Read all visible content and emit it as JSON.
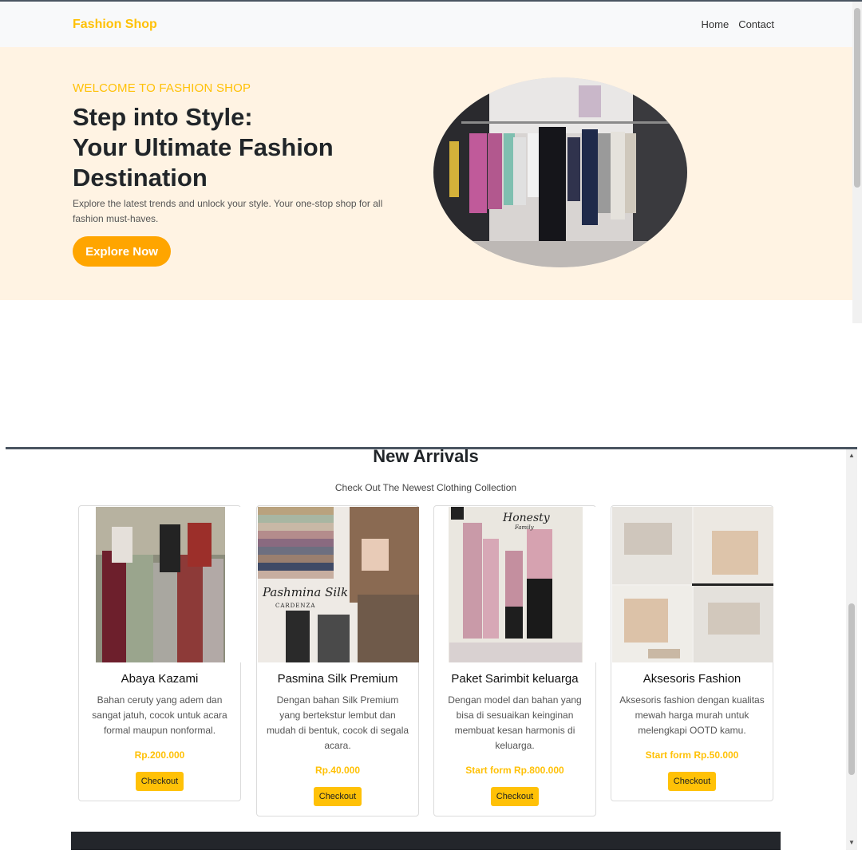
{
  "navbar": {
    "brand": "Fashion Shop",
    "links": [
      "Home",
      "Contact"
    ]
  },
  "hero": {
    "kicker": "WELCOME TO FASHION SHOP",
    "title_lines": [
      "Step into Style:",
      "Your Ultimate Fashion",
      "Destination"
    ],
    "description": "Explore the latest trends and unlock your style. Your one-stop shop for all fashion must-haves.",
    "button_label": "Explore Now"
  },
  "new_arrivals": {
    "title": "New Arrivals",
    "subtitle": "Check Out The Newest Clothing Collection",
    "products": [
      {
        "name": "Abaya Kazami",
        "description": "Bahan ceruty yang adem dan sangat jatuh, cocok untuk acara formal maupun nonformal.",
        "price": "Rp.200.000",
        "button_label": "Checkout"
      },
      {
        "name": "Pasmina Silk Premium",
        "description": "Dengan bahan Silk Premium yang bertekstur lembut dan mudah di bentuk, cocok di segala acara.",
        "price": "Rp.40.000",
        "button_label": "Checkout",
        "image_text": [
          "Pashmina Silk",
          "CARDENZA"
        ]
      },
      {
        "name": "Paket Sarimbit keluarga",
        "description": "Dengan model dan bahan yang bisa di sesuaikan keinginan membuat kesan harmonis di keluarga.",
        "price": "Start form Rp.800.000",
        "button_label": "Checkout",
        "image_text": [
          "Honesty",
          "Family"
        ]
      },
      {
        "name": "Aksesoris Fashion",
        "description": "Aksesoris fashion dengan kualitas mewah harga murah untuk melengkapi OOTD kamu.",
        "price": "Start form Rp.50.000",
        "button_label": "Checkout"
      }
    ]
  },
  "colors": {
    "accent": "#ffc107",
    "hero_button": "#ffa500",
    "hero_background": "#fff3e3",
    "navbar_background": "#f8f9fa",
    "footer": "#23262b"
  },
  "icons": [
    "scroll-up-arrow-icon",
    "scroll-down-arrow-icon"
  ]
}
